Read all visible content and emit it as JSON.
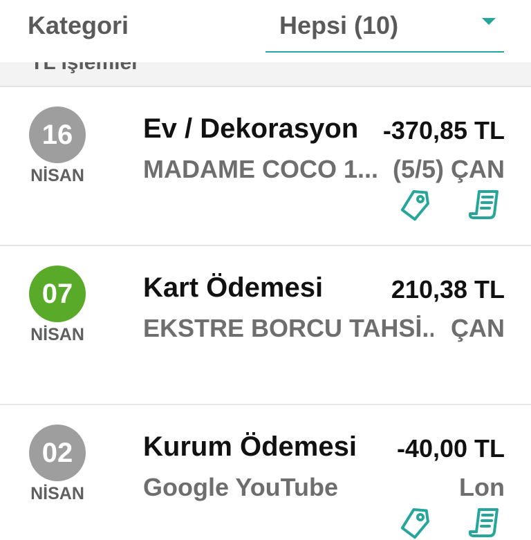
{
  "filter": {
    "label": "Kategori",
    "selected": "Hepsi (10)",
    "dropdown_icon": "chevron-down-icon"
  },
  "section": {
    "title": "TL İşlemler"
  },
  "colors": {
    "accent": "#26a69a",
    "date_default": "#9e9e9e",
    "date_payment": "#5aaa2a"
  },
  "transactions": [
    {
      "day": "16",
      "month": "NİSAN",
      "category": "Ev / Dekorasyon",
      "amount": "-370,85 TL",
      "description": "MADAME COCO 1...",
      "installment": "(5/5)",
      "user": "ÇAN",
      "icons": [
        "tag-icon",
        "receipt-icon"
      ]
    },
    {
      "day": "07",
      "month": "NİSAN",
      "category": "Kart Ödemesi",
      "amount": "210,38 TL",
      "description": "EKSTRE BORCU TAHSİ...",
      "user": "ÇAN",
      "icons": []
    },
    {
      "day": "02",
      "month": "NİSAN",
      "category": "Kurum Ödemesi",
      "amount": "-40,00 TL",
      "description": "Google YouTube",
      "user": "Lon",
      "icons": [
        "tag-icon",
        "receipt-icon"
      ]
    }
  ]
}
